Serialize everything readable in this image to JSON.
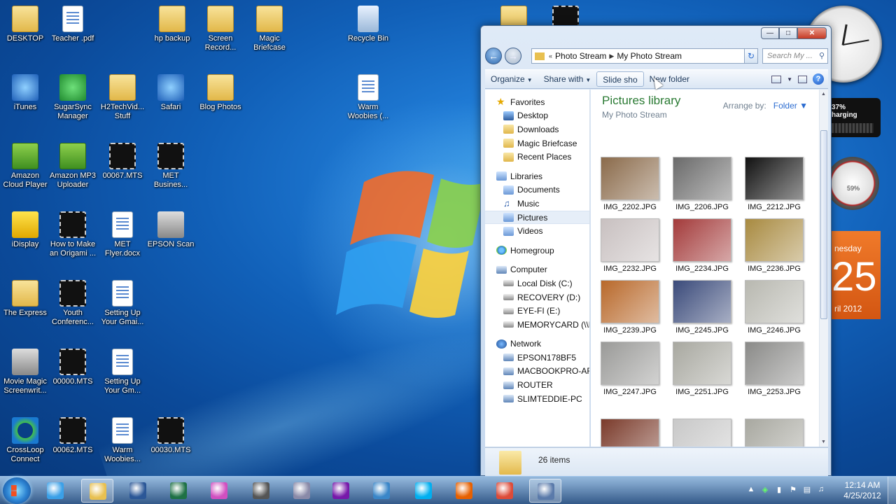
{
  "desktop": {
    "icons": [
      {
        "label": "DESKTOP",
        "icon": "desktop-shortcut-icon"
      },
      {
        "label": "Teacher .pdf",
        "icon": "pdf-file-icon"
      },
      {
        "label": "hp backup",
        "icon": "folder-icon"
      },
      {
        "label": "Screen Record...",
        "icon": "folder-icon"
      },
      {
        "label": "Magic Briefcase",
        "icon": "folder-icon"
      },
      {
        "label": "Recycle Bin",
        "icon": "recycle-bin-icon"
      },
      {
        "label": "iTunes",
        "icon": "itunes-icon"
      },
      {
        "label": "SugarSync Manager",
        "icon": "sugarsync-icon"
      },
      {
        "label": "H2TechVid... Stuff",
        "icon": "folder-icon"
      },
      {
        "label": "Safari",
        "icon": "safari-icon"
      },
      {
        "label": "Blog Photos",
        "icon": "folder-icon"
      },
      {
        "label": "Warm Woobies (...",
        "icon": "document-icon"
      },
      {
        "label": "Amazon Cloud Player",
        "icon": "amazon-icon"
      },
      {
        "label": "Amazon MP3 Uploader",
        "icon": "amazon-icon"
      },
      {
        "label": "00067.MTS",
        "icon": "video-file-icon"
      },
      {
        "label": "MET Busines...",
        "icon": "video-file-icon"
      },
      {
        "label": "iDisplay",
        "icon": "idisplay-icon"
      },
      {
        "label": "How to Make an Origami ...",
        "icon": "video-file-icon"
      },
      {
        "label": "MET Flyer.docx",
        "icon": "document-icon"
      },
      {
        "label": "EPSON Scan",
        "icon": "scanner-icon"
      },
      {
        "label": "The Express",
        "icon": "folder-icon"
      },
      {
        "label": "Youth Conferenc...",
        "icon": "video-file-icon"
      },
      {
        "label": "Setting Up Your Gmai...",
        "icon": "document-icon"
      },
      {
        "label": "Movie Magic Screenwrit...",
        "icon": "movie-magic-icon"
      },
      {
        "label": "00000.MTS",
        "icon": "video-file-icon"
      },
      {
        "label": "Setting Up Your Gm...",
        "icon": "document-icon"
      },
      {
        "label": "CrossLoop Connect",
        "icon": "crossloop-icon"
      },
      {
        "label": "00062.MTS",
        "icon": "video-file-icon"
      },
      {
        "label": "Warm Woobies...",
        "icon": "document-icon"
      },
      {
        "label": "00030.MTS",
        "icon": "video-file-icon"
      }
    ]
  },
  "gadgets": {
    "battery_percent": "37%",
    "battery_status": "harging",
    "cpu_meter": "59%",
    "calendar_day": "nesday",
    "calendar_num": "25",
    "calendar_date": "ril 2012"
  },
  "explorer": {
    "breadcrumb": [
      "Photo Stream",
      "My Photo Stream"
    ],
    "search_placeholder": "Search My ...",
    "commands": [
      {
        "label": "Organize",
        "dropdown": true
      },
      {
        "label": "Share with",
        "dropdown": true
      },
      {
        "label": "Slide sho",
        "dropdown": false
      },
      {
        "label": "New folder",
        "dropdown": false
      }
    ],
    "nav": {
      "favorites": "Favorites",
      "fav_items": [
        "Desktop",
        "Downloads",
        "Magic Briefcase",
        "Recent Places"
      ],
      "libraries": "Libraries",
      "lib_items": [
        "Documents",
        "Music",
        "Pictures",
        "Videos"
      ],
      "homegroup": "Homegroup",
      "computer": "Computer",
      "comp_items": [
        "Local Disk (C:)",
        "RECOVERY (D:)",
        "EYE-FI (E:)",
        "MEMORYCARD (\\\\E"
      ],
      "network": "Network",
      "net_items": [
        "EPSON178BF5",
        "MACBOOKPRO-AFA",
        "ROUTER",
        "SLIMTEDDIE-PC"
      ]
    },
    "library_title": "Pictures library",
    "library_sub": "My Photo Stream",
    "arrange_label": "Arrange by:",
    "arrange_value": "Folder",
    "files": [
      {
        "name": "IMG_2202.JPG",
        "color": "#8a6a4a"
      },
      {
        "name": "IMG_2206.JPG",
        "color": "#6a6a6a"
      },
      {
        "name": "IMG_2212.JPG",
        "color": "#111111"
      },
      {
        "name": "IMG_2232.JPG",
        "color": "#c8c0c0"
      },
      {
        "name": "IMG_2234.JPG",
        "color": "#a33a3a"
      },
      {
        "name": "IMG_2236.JPG",
        "color": "#a88a40"
      },
      {
        "name": "IMG_2239.JPG",
        "color": "#b8682a"
      },
      {
        "name": "IMG_2245.JPG",
        "color": "#3a4a7a"
      },
      {
        "name": "IMG_2246.JPG",
        "color": "#b8b8b0"
      },
      {
        "name": "IMG_2247.JPG",
        "color": "#9a9a98"
      },
      {
        "name": "IMG_2251.JPG",
        "color": "#a8a8a0"
      },
      {
        "name": "IMG_2253.JPG",
        "color": "#8a8a88"
      },
      {
        "name": "",
        "color": "#7a3a2a"
      },
      {
        "name": "",
        "color": "#c8c8c8"
      },
      {
        "name": "",
        "color": "#a8a8a0"
      }
    ],
    "item_count": "26 items"
  },
  "taskbar": {
    "pinned": [
      "internet-explorer-icon",
      "file-explorer-icon",
      "word-icon",
      "excel-icon",
      "media-icon",
      "itunes-icon",
      "onenote-alt-icon",
      "onenote-icon",
      "paint-icon",
      "skype-icon",
      "firefox-icon",
      "chrome-icon",
      "video-editor-icon"
    ],
    "time": "12:14 AM",
    "date": "4/25/2012"
  }
}
